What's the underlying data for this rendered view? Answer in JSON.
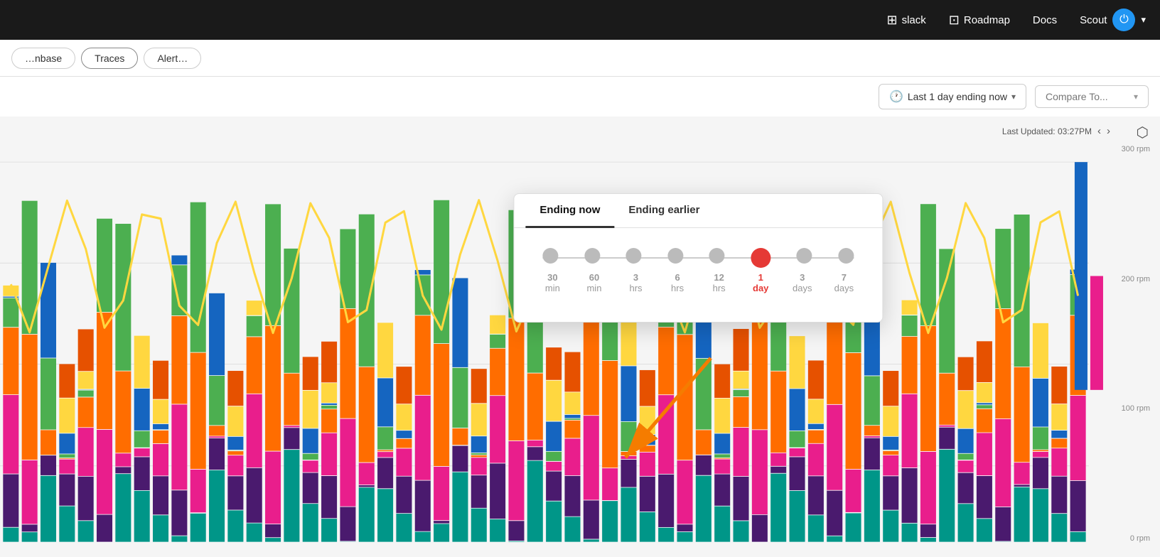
{
  "nav": {
    "slack_label": "slack",
    "roadmap_label": "Roadmap",
    "docs_label": "Docs",
    "scout_label": "Scout",
    "power_icon": "⏻",
    "dropdown_icon": "▾"
  },
  "tabs": [
    {
      "id": "database",
      "label": "…nbase"
    },
    {
      "id": "traces",
      "label": "Traces"
    },
    {
      "id": "alerts",
      "label": "Alert…"
    }
  ],
  "header": {
    "time_label": "Last 1 day ending now",
    "compare_label": "Compare To...",
    "last_updated": "Last Updated: 03:27PM",
    "export_icon": "↗"
  },
  "popup": {
    "tab_ending_now": "Ending now",
    "tab_ending_earlier": "Ending earlier",
    "timeline_options": [
      {
        "value": "30",
        "unit": "min",
        "selected": false
      },
      {
        "value": "60",
        "unit": "min",
        "selected": false
      },
      {
        "value": "3",
        "unit": "hrs",
        "selected": false
      },
      {
        "value": "6",
        "unit": "hrs",
        "selected": false
      },
      {
        "value": "12",
        "unit": "hrs",
        "selected": false
      },
      {
        "value": "1",
        "unit": "day",
        "selected": true
      },
      {
        "value": "3",
        "unit": "days",
        "selected": false
      },
      {
        "value": "7",
        "unit": "days",
        "selected": false
      }
    ]
  },
  "chart": {
    "y_labels": [
      "300 rpm",
      "200 rpm",
      "100 rpm",
      "0 rpm"
    ],
    "colors": {
      "teal": "#009688",
      "purple": "#4a1a6e",
      "magenta": "#e91e8c",
      "orange": "#ff6d00",
      "yellow_line": "#ffd740",
      "green": "#4caf50",
      "blue": "#1565c0",
      "dark_orange": "#e65100"
    }
  }
}
